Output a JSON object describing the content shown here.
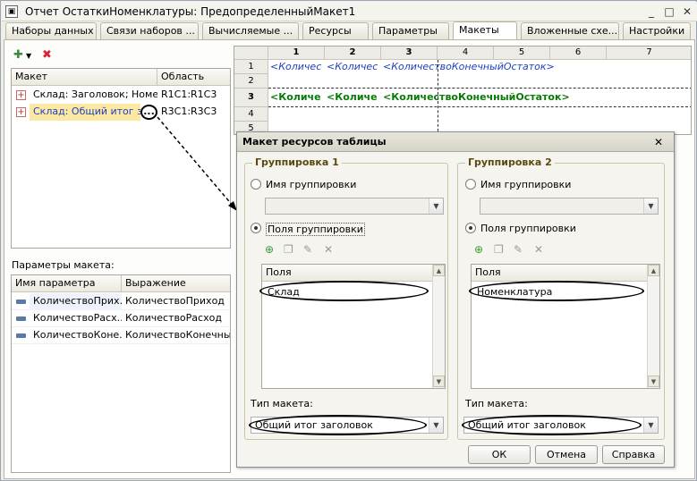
{
  "window": {
    "title": "Отчет ОстаткиНоменклатуры: ПредопределенныйМакет1",
    "controls": [
      "_",
      "□",
      "✕"
    ]
  },
  "tabs": [
    {
      "label": "Наборы данных"
    },
    {
      "label": "Связи наборов ..."
    },
    {
      "label": "Вычисляемые ..."
    },
    {
      "label": "Ресурсы"
    },
    {
      "label": "Параметры"
    },
    {
      "label": "Макеты"
    },
    {
      "label": "Вложенные схе..."
    },
    {
      "label": "Настройки"
    }
  ],
  "layouts_list": {
    "columns": [
      "Макет",
      "Область"
    ],
    "rows": [
      {
        "name": "Склад: Заголовок; Номе...",
        "area": "R1C1:R1C3"
      },
      {
        "name": "Склад: Общий итог заго...",
        "area": "R3C1:R3C3"
      }
    ],
    "ellipsis_button": "..."
  },
  "params": {
    "title": "Параметры макета:",
    "columns": [
      "Имя параметра",
      "Выражение"
    ],
    "rows": [
      {
        "name": "КоличествоПрих...",
        "expr": "КоличествоПриход"
      },
      {
        "name": "КоличествоРасх...",
        "expr": "КоличествоРасход"
      },
      {
        "name": "КоличествоКоне...",
        "expr": "КоличествоКонечны..."
      }
    ]
  },
  "sheet": {
    "col_headers": [
      "1",
      "2",
      "3",
      "4",
      "5",
      "6",
      "7"
    ],
    "row_headers": [
      "1",
      "2",
      "3",
      "4",
      "5"
    ],
    "row1": [
      "<Количес",
      "<Количес",
      "<КоличествоКонечныйОстаток>"
    ],
    "row3": [
      "<Количе",
      "<Количе",
      "<КоличествоКонечныйОстаток>"
    ]
  },
  "dialog": {
    "title": "Макет ресурсов таблицы",
    "close": "✕",
    "group1": {
      "legend": "Группировка 1",
      "radio_name": "Имя группировки",
      "radio_fields": "Поля группировки",
      "fields_header": "Поля",
      "fields": [
        "Склад"
      ],
      "type_label": "Тип макета:",
      "type_value": "Общий итог заголовок"
    },
    "group2": {
      "legend": "Группировка 2",
      "radio_name": "Имя группировки",
      "radio_fields": "Поля группировки",
      "fields_header": "Поля",
      "fields": [
        "Номенклатура"
      ],
      "type_label": "Тип макета:",
      "type_value": "Общий итог заголовок"
    },
    "buttons": {
      "ok": "ОК",
      "cancel": "Отмена",
      "help": "Справка"
    }
  },
  "colors": {
    "accent_blue": "#1f3fbf",
    "row3_green": "#0a7a0a",
    "selection": "#fbe9a3",
    "tab_active": "#ffffff"
  }
}
